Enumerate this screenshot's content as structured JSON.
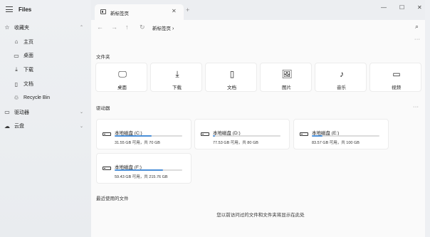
{
  "app": {
    "title": "Files"
  },
  "window_controls": {
    "minimize": "—",
    "maximize": "☐",
    "close": "✕"
  },
  "sidebar": {
    "items": [
      {
        "id": "favorites",
        "label": "收藏夹",
        "icon": "star-icon",
        "glyph": "☆",
        "level": 0,
        "expand": "⌃"
      },
      {
        "id": "home",
        "label": "主页",
        "icon": "home-icon",
        "glyph": "⌂",
        "level": 1
      },
      {
        "id": "desktop",
        "label": "桌面",
        "icon": "desktop-icon",
        "glyph": "▭",
        "level": 1
      },
      {
        "id": "downloads",
        "label": "下载",
        "icon": "download-icon",
        "glyph": "⤓",
        "level": 1
      },
      {
        "id": "documents",
        "label": "文档",
        "icon": "document-icon",
        "glyph": "▯",
        "level": 1
      },
      {
        "id": "recycle-bin",
        "label": "Recycle Bin",
        "icon": "recycle-bin-icon",
        "glyph": "♲",
        "level": 1
      },
      {
        "id": "drives",
        "label": "驱动器",
        "icon": "drive-icon",
        "glyph": "▭",
        "level": 0,
        "expand": "⌄"
      },
      {
        "id": "cloud",
        "label": "云盘",
        "icon": "cloud-icon",
        "glyph": "☁",
        "level": 0,
        "expand": "⌄"
      }
    ]
  },
  "tabs": [
    {
      "label": "新标签页",
      "close": "✕"
    }
  ],
  "new_tab": "+",
  "toolbar": {
    "back": "←",
    "forward": "→",
    "up": "↑",
    "refresh": "↻",
    "search": "⌕"
  },
  "breadcrumb": {
    "label": "新标签页",
    "arrow": "›"
  },
  "more": "···",
  "sections": {
    "folders_title": "文件夹",
    "drives_title": "驱动器",
    "recent_title": "最近使用的文件",
    "recent_empty": "您以前访问过的文件和文件夹将显示在此处"
  },
  "folders": [
    {
      "label": "桌面",
      "icon": "desktop-icon",
      "glyph": "🖵"
    },
    {
      "label": "下载",
      "icon": "download-icon",
      "glyph": "⤓"
    },
    {
      "label": "文档",
      "icon": "document-icon",
      "glyph": "▯"
    },
    {
      "label": "图片",
      "icon": "picture-icon",
      "glyph": "🖼"
    },
    {
      "label": "音乐",
      "icon": "music-icon",
      "glyph": "♪"
    },
    {
      "label": "视频",
      "icon": "video-icon",
      "glyph": "▭"
    }
  ],
  "drives": [
    {
      "name": "本地磁盘 (C:)",
      "space": "31.55 GB 可用，共 70 GB",
      "used_fraction": 0.55
    },
    {
      "name": "本地磁盘 (D:)",
      "space": "77.53 GB 可用，共 80 GB",
      "used_fraction": 0.03
    },
    {
      "name": "本地磁盘 (E:)",
      "space": "83.57 GB 可用，共 100 GB",
      "used_fraction": 0.16
    },
    {
      "name": "本地磁盘 (F:)",
      "space": "59.43 GB 可用，共 215.76 GB",
      "used_fraction": 0.72
    }
  ],
  "colors": {
    "accent": "#4a8fd8",
    "sidebar_bg": "#eef0f3",
    "content_bg": "#fafafa"
  }
}
